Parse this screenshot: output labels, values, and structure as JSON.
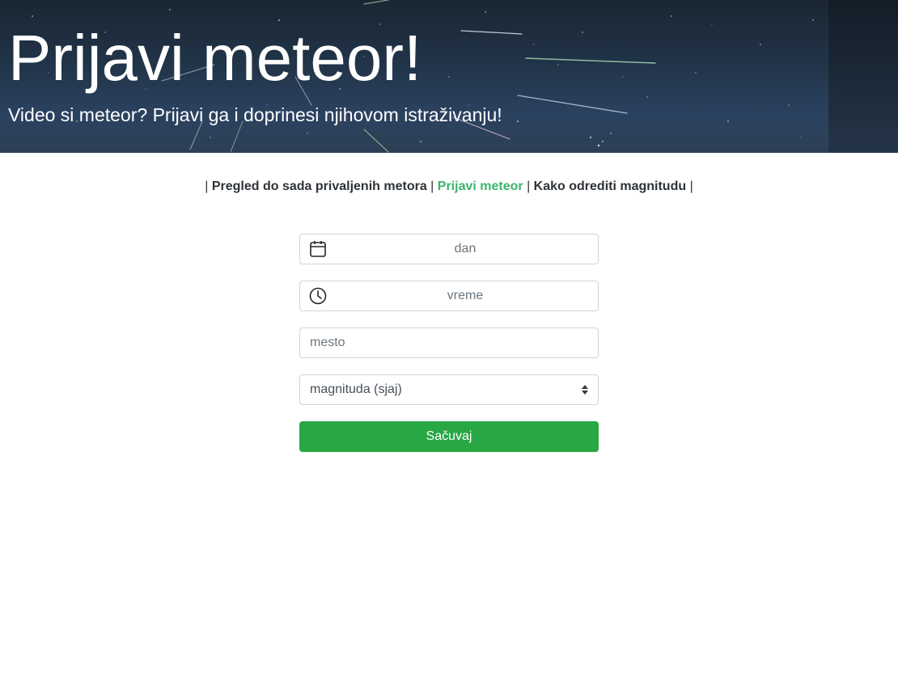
{
  "header": {
    "title": "Prijavi meteor!",
    "subtitle": "Video si meteor? Prijavi ga i doprinesi njihovom istraživanju!"
  },
  "nav": {
    "separator": "|",
    "items": [
      {
        "label": "Pregled do sada privaljenih metora",
        "active": false
      },
      {
        "label": "Prijavi meteor",
        "active": true
      },
      {
        "label": "Kako odrediti magnitudu",
        "active": false
      }
    ]
  },
  "form": {
    "date_placeholder": "dan",
    "time_placeholder": "vreme",
    "place_placeholder": "mesto",
    "magnitude_selected": "magnituda (sjaj)",
    "save_label": "Sačuvaj"
  },
  "colors": {
    "accent_green": "#28a745",
    "active_link": "#3bb46b",
    "sky_dark": "#1a2633"
  }
}
